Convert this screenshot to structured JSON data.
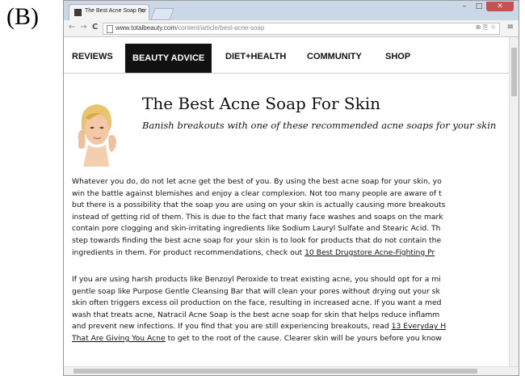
{
  "figure_label": "(B)",
  "browser": {
    "tab_title": "The Best Acne Soap For",
    "url_domain": "www.totalbeauty.com",
    "url_path": "/content/article/best-acne-soap",
    "nav_back": "←",
    "nav_forward": "→",
    "nav_reload": "C",
    "menu_icon": "≡"
  },
  "site_nav": {
    "items": [
      "REVIEWS",
      "BEAUTY ADVICE",
      "DIET+HEALTH",
      "COMMUNITY",
      "SHOP"
    ]
  },
  "article": {
    "title": "The Best Acne Soap For Skin",
    "subtitle": "Banish breakouts with one of these recommended acne soaps for your skin",
    "p1": [
      "Whatever you do, do not let acne get the best of you. By using the best acne soap for your skin, yo",
      "win the battle against blemishes and enjoy a clear complexion. Not too many people are aware of t",
      "but there is a possibility that the soap you are using on your skin is actually causing more breakouts",
      "instead of getting rid of them. This is due to the fact that many face washes and soaps on the mark",
      "contain pore clogging and skin-irritating ingredients like Sodium Lauryl Sulfate and Stearic Acid. Th",
      "step towards finding the best acne soap for your skin is to look for products that do not contain the"
    ],
    "p1_last_text": "ingredients in them. For product recommendations, check out ",
    "p1_link": "10 Best Drugstore Acne-Fighting Pr",
    "p2": [
      "If you are using harsh products like Benzoyl Peroxide to treat existing acne, you should opt for a mi",
      "gentle soap like Purpose Gentle Cleansing Bar that will clean your pores without drying out your sk",
      "skin often triggers excess oil production on the face, resulting in increased acne. If you want a med",
      "wash that treats acne, Natracil Acne Soap is the best acne soap for skin that helps reduce inflamm",
      "and prevent new infections. If you find that you are still experiencing breakouts, read "
    ],
    "p2_link_a": "13 Everyday H",
    "p2_last_link": "That Are Giving You Acne",
    "p2_last_text": " to get to the root of the cause. Clearer skin will be yours before you know"
  }
}
